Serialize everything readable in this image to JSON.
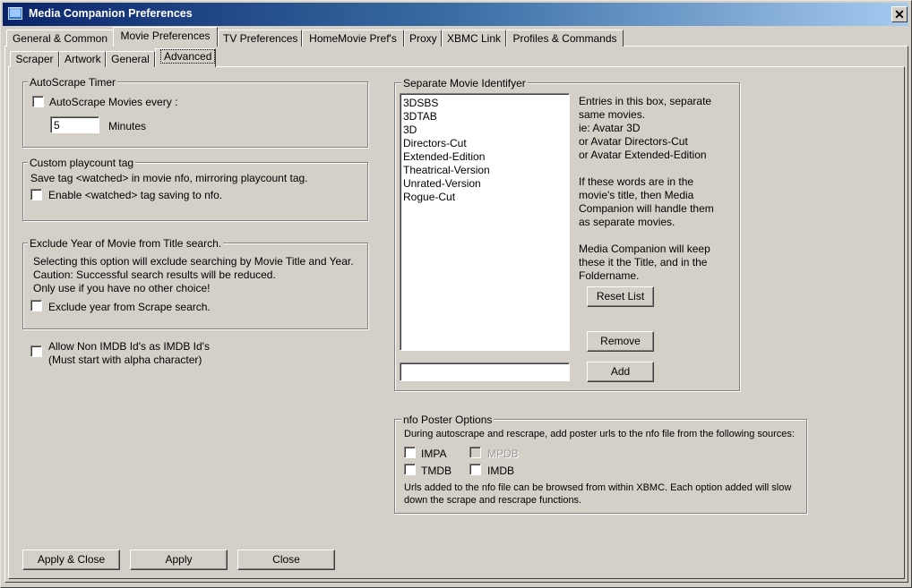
{
  "window": {
    "title": "Media Companion Preferences",
    "close_symbol": "✕",
    "icon": "app-window-icon"
  },
  "main_tabs": [
    {
      "label": "General & Common",
      "active": false
    },
    {
      "label": "Movie Preferences",
      "active": true
    },
    {
      "label": "TV Preferences",
      "active": false
    },
    {
      "label": "HomeMovie Pref's",
      "active": false
    },
    {
      "label": "Proxy",
      "active": false
    },
    {
      "label": "XBMC Link",
      "active": false
    },
    {
      "label": "Profiles & Commands",
      "active": false
    }
  ],
  "sub_tabs": [
    {
      "label": "Scraper",
      "active": false
    },
    {
      "label": "Artwork",
      "active": false
    },
    {
      "label": "General",
      "active": false
    },
    {
      "label": "Advanced",
      "active": true
    }
  ],
  "autoscrape": {
    "legend": "AutoScrape Timer",
    "checkbox_label": "AutoScrape Movies every :",
    "checked": false,
    "minutes_value": "5",
    "minutes_label": "Minutes"
  },
  "playcount": {
    "legend": "Custom playcount tag",
    "description": "Save tag <watched> in movie nfo, mirroring playcount tag.",
    "checkbox_label": "Enable <watched> tag saving to nfo.",
    "checked": false
  },
  "exclude_year": {
    "legend": "Exclude Year of Movie from Title search.",
    "line1": "Selecting this option will exclude searching by Movie Title and Year.",
    "line2": "Caution:  Successful search results will be reduced.",
    "line3": "Only use if you have no other choice!",
    "checkbox_label": "Exclude year from Scrape search.",
    "checked": false
  },
  "non_imdb": {
    "label_line1": "Allow Non IMDB Id's as IMDB Id's",
    "label_line2": "(Must start with alpha character)",
    "checked": false
  },
  "separate_movie": {
    "legend": "Separate Movie Identifyer",
    "items": [
      "3DSBS",
      "3DTAB",
      "3D",
      "Directors-Cut",
      "Extended-Edition",
      "Theatrical-Version",
      "Unrated-Version",
      "Rogue-Cut"
    ],
    "help_lines": [
      "Entries in this box, separate",
      "same movies.",
      "ie: Avatar 3D",
      "or Avatar Directors-Cut",
      "or Avatar Extended-Edition",
      "",
      "If these words are in the",
      "movie's title, then Media",
      "Companion will handle them",
      "as separate movies.",
      "",
      "Media Companion will keep",
      "these it the Title, and in the",
      "Foldername."
    ],
    "reset_label": "Reset List",
    "remove_label": "Remove",
    "add_label": "Add",
    "new_entry_value": ""
  },
  "nfo_poster": {
    "legend": "nfo Poster Options",
    "description": "During autoscrape and rescrape, add poster urls to the nfo file from the following sources:",
    "options": [
      {
        "label": "IMPA",
        "checked": false,
        "enabled": true
      },
      {
        "label": "MPDB",
        "checked": false,
        "enabled": false
      },
      {
        "label": "TMDB",
        "checked": false,
        "enabled": true
      },
      {
        "label": "IMDB",
        "checked": false,
        "enabled": true
      }
    ],
    "note_line1": "Urls added to the nfo file can be browsed from within XBMC. Each option added will slow",
    "note_line2": "down the scrape and rescrape functions."
  },
  "footer": {
    "apply_close_label": "Apply  &  Close",
    "apply_label": "Apply",
    "close_label": "Close"
  }
}
